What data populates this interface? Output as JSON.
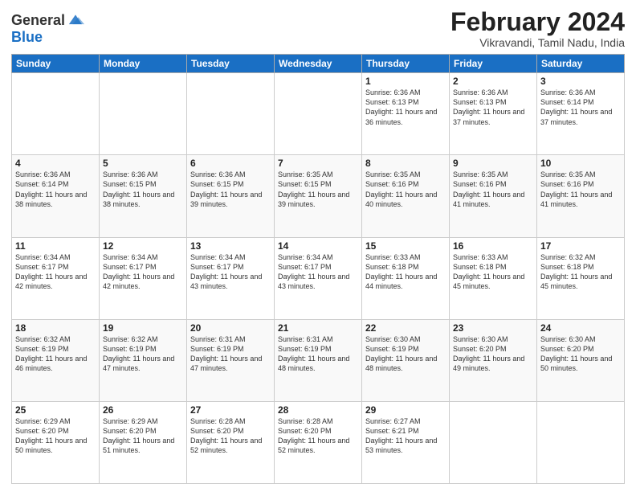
{
  "logo": {
    "line1": "General",
    "line2": "Blue"
  },
  "calendar": {
    "title": "February 2024",
    "subtitle": "Vikravandi, Tamil Nadu, India"
  },
  "weekdays": [
    "Sunday",
    "Monday",
    "Tuesday",
    "Wednesday",
    "Thursday",
    "Friday",
    "Saturday"
  ],
  "weeks": [
    [
      {
        "day": "",
        "info": ""
      },
      {
        "day": "",
        "info": ""
      },
      {
        "day": "",
        "info": ""
      },
      {
        "day": "",
        "info": ""
      },
      {
        "day": "1",
        "info": "Sunrise: 6:36 AM\nSunset: 6:13 PM\nDaylight: 11 hours and 36 minutes."
      },
      {
        "day": "2",
        "info": "Sunrise: 6:36 AM\nSunset: 6:13 PM\nDaylight: 11 hours and 37 minutes."
      },
      {
        "day": "3",
        "info": "Sunrise: 6:36 AM\nSunset: 6:14 PM\nDaylight: 11 hours and 37 minutes."
      }
    ],
    [
      {
        "day": "4",
        "info": "Sunrise: 6:36 AM\nSunset: 6:14 PM\nDaylight: 11 hours and 38 minutes."
      },
      {
        "day": "5",
        "info": "Sunrise: 6:36 AM\nSunset: 6:15 PM\nDaylight: 11 hours and 38 minutes."
      },
      {
        "day": "6",
        "info": "Sunrise: 6:36 AM\nSunset: 6:15 PM\nDaylight: 11 hours and 39 minutes."
      },
      {
        "day": "7",
        "info": "Sunrise: 6:35 AM\nSunset: 6:15 PM\nDaylight: 11 hours and 39 minutes."
      },
      {
        "day": "8",
        "info": "Sunrise: 6:35 AM\nSunset: 6:16 PM\nDaylight: 11 hours and 40 minutes."
      },
      {
        "day": "9",
        "info": "Sunrise: 6:35 AM\nSunset: 6:16 PM\nDaylight: 11 hours and 41 minutes."
      },
      {
        "day": "10",
        "info": "Sunrise: 6:35 AM\nSunset: 6:16 PM\nDaylight: 11 hours and 41 minutes."
      }
    ],
    [
      {
        "day": "11",
        "info": "Sunrise: 6:34 AM\nSunset: 6:17 PM\nDaylight: 11 hours and 42 minutes."
      },
      {
        "day": "12",
        "info": "Sunrise: 6:34 AM\nSunset: 6:17 PM\nDaylight: 11 hours and 42 minutes."
      },
      {
        "day": "13",
        "info": "Sunrise: 6:34 AM\nSunset: 6:17 PM\nDaylight: 11 hours and 43 minutes."
      },
      {
        "day": "14",
        "info": "Sunrise: 6:34 AM\nSunset: 6:17 PM\nDaylight: 11 hours and 43 minutes."
      },
      {
        "day": "15",
        "info": "Sunrise: 6:33 AM\nSunset: 6:18 PM\nDaylight: 11 hours and 44 minutes."
      },
      {
        "day": "16",
        "info": "Sunrise: 6:33 AM\nSunset: 6:18 PM\nDaylight: 11 hours and 45 minutes."
      },
      {
        "day": "17",
        "info": "Sunrise: 6:32 AM\nSunset: 6:18 PM\nDaylight: 11 hours and 45 minutes."
      }
    ],
    [
      {
        "day": "18",
        "info": "Sunrise: 6:32 AM\nSunset: 6:19 PM\nDaylight: 11 hours and 46 minutes."
      },
      {
        "day": "19",
        "info": "Sunrise: 6:32 AM\nSunset: 6:19 PM\nDaylight: 11 hours and 47 minutes."
      },
      {
        "day": "20",
        "info": "Sunrise: 6:31 AM\nSunset: 6:19 PM\nDaylight: 11 hours and 47 minutes."
      },
      {
        "day": "21",
        "info": "Sunrise: 6:31 AM\nSunset: 6:19 PM\nDaylight: 11 hours and 48 minutes."
      },
      {
        "day": "22",
        "info": "Sunrise: 6:30 AM\nSunset: 6:19 PM\nDaylight: 11 hours and 48 minutes."
      },
      {
        "day": "23",
        "info": "Sunrise: 6:30 AM\nSunset: 6:20 PM\nDaylight: 11 hours and 49 minutes."
      },
      {
        "day": "24",
        "info": "Sunrise: 6:30 AM\nSunset: 6:20 PM\nDaylight: 11 hours and 50 minutes."
      }
    ],
    [
      {
        "day": "25",
        "info": "Sunrise: 6:29 AM\nSunset: 6:20 PM\nDaylight: 11 hours and 50 minutes."
      },
      {
        "day": "26",
        "info": "Sunrise: 6:29 AM\nSunset: 6:20 PM\nDaylight: 11 hours and 51 minutes."
      },
      {
        "day": "27",
        "info": "Sunrise: 6:28 AM\nSunset: 6:20 PM\nDaylight: 11 hours and 52 minutes."
      },
      {
        "day": "28",
        "info": "Sunrise: 6:28 AM\nSunset: 6:20 PM\nDaylight: 11 hours and 52 minutes."
      },
      {
        "day": "29",
        "info": "Sunrise: 6:27 AM\nSunset: 6:21 PM\nDaylight: 11 hours and 53 minutes."
      },
      {
        "day": "",
        "info": ""
      },
      {
        "day": "",
        "info": ""
      }
    ]
  ]
}
